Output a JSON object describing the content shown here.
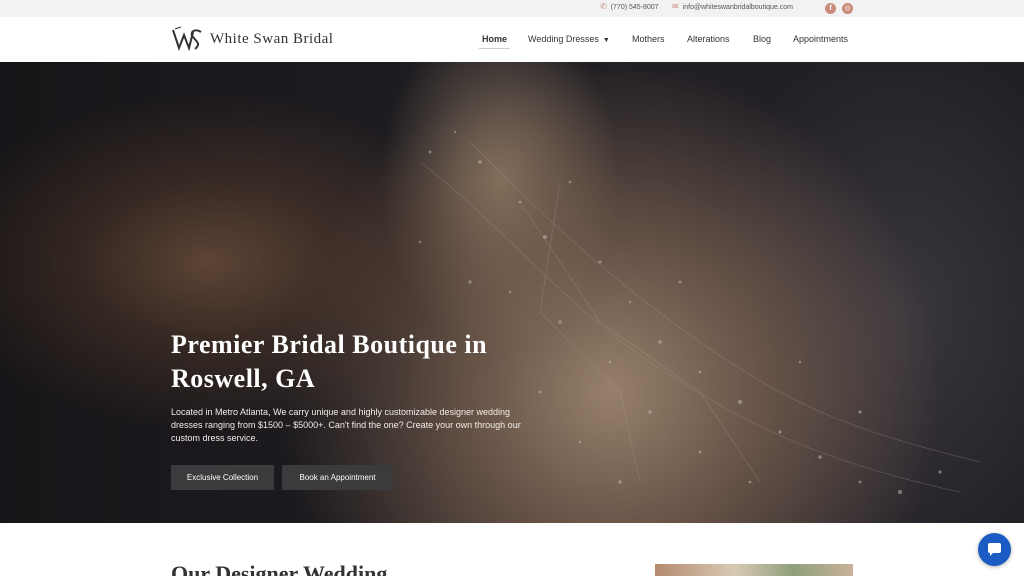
{
  "topbar": {
    "phone": "(770) 545-8007",
    "email": "info@whiteswanbridalboutique.com",
    "phone_icon": "phone-icon",
    "email_icon": "mail-icon",
    "social": [
      {
        "name": "facebook-icon",
        "glyph": "f"
      },
      {
        "name": "instagram-icon",
        "glyph": "◎"
      }
    ]
  },
  "header": {
    "logo_text": "White Swan Bridal",
    "nav": [
      {
        "label": "Home",
        "active": true
      },
      {
        "label": "Wedding Dresses",
        "has_dropdown": true
      },
      {
        "label": "Mothers"
      },
      {
        "label": "Alterations"
      },
      {
        "label": "Blog"
      },
      {
        "label": "Appointments"
      }
    ]
  },
  "hero": {
    "title": "Premier Bridal Boutique in Roswell, GA",
    "description": "Located in Metro Atlanta, We carry unique and highly customizable designer wedding dresses ranging from $1500 – $5000+. Can't find the one? Create your own through our custom dress service.",
    "buttons": [
      "Exclusive Collection",
      "Book an Appointment"
    ]
  },
  "section": {
    "title": "Our Designer Wedding"
  },
  "colors": {
    "accent": "#c98a7a",
    "button_bg": "#3b3a3c",
    "chat_bg": "#1a5cc4"
  }
}
